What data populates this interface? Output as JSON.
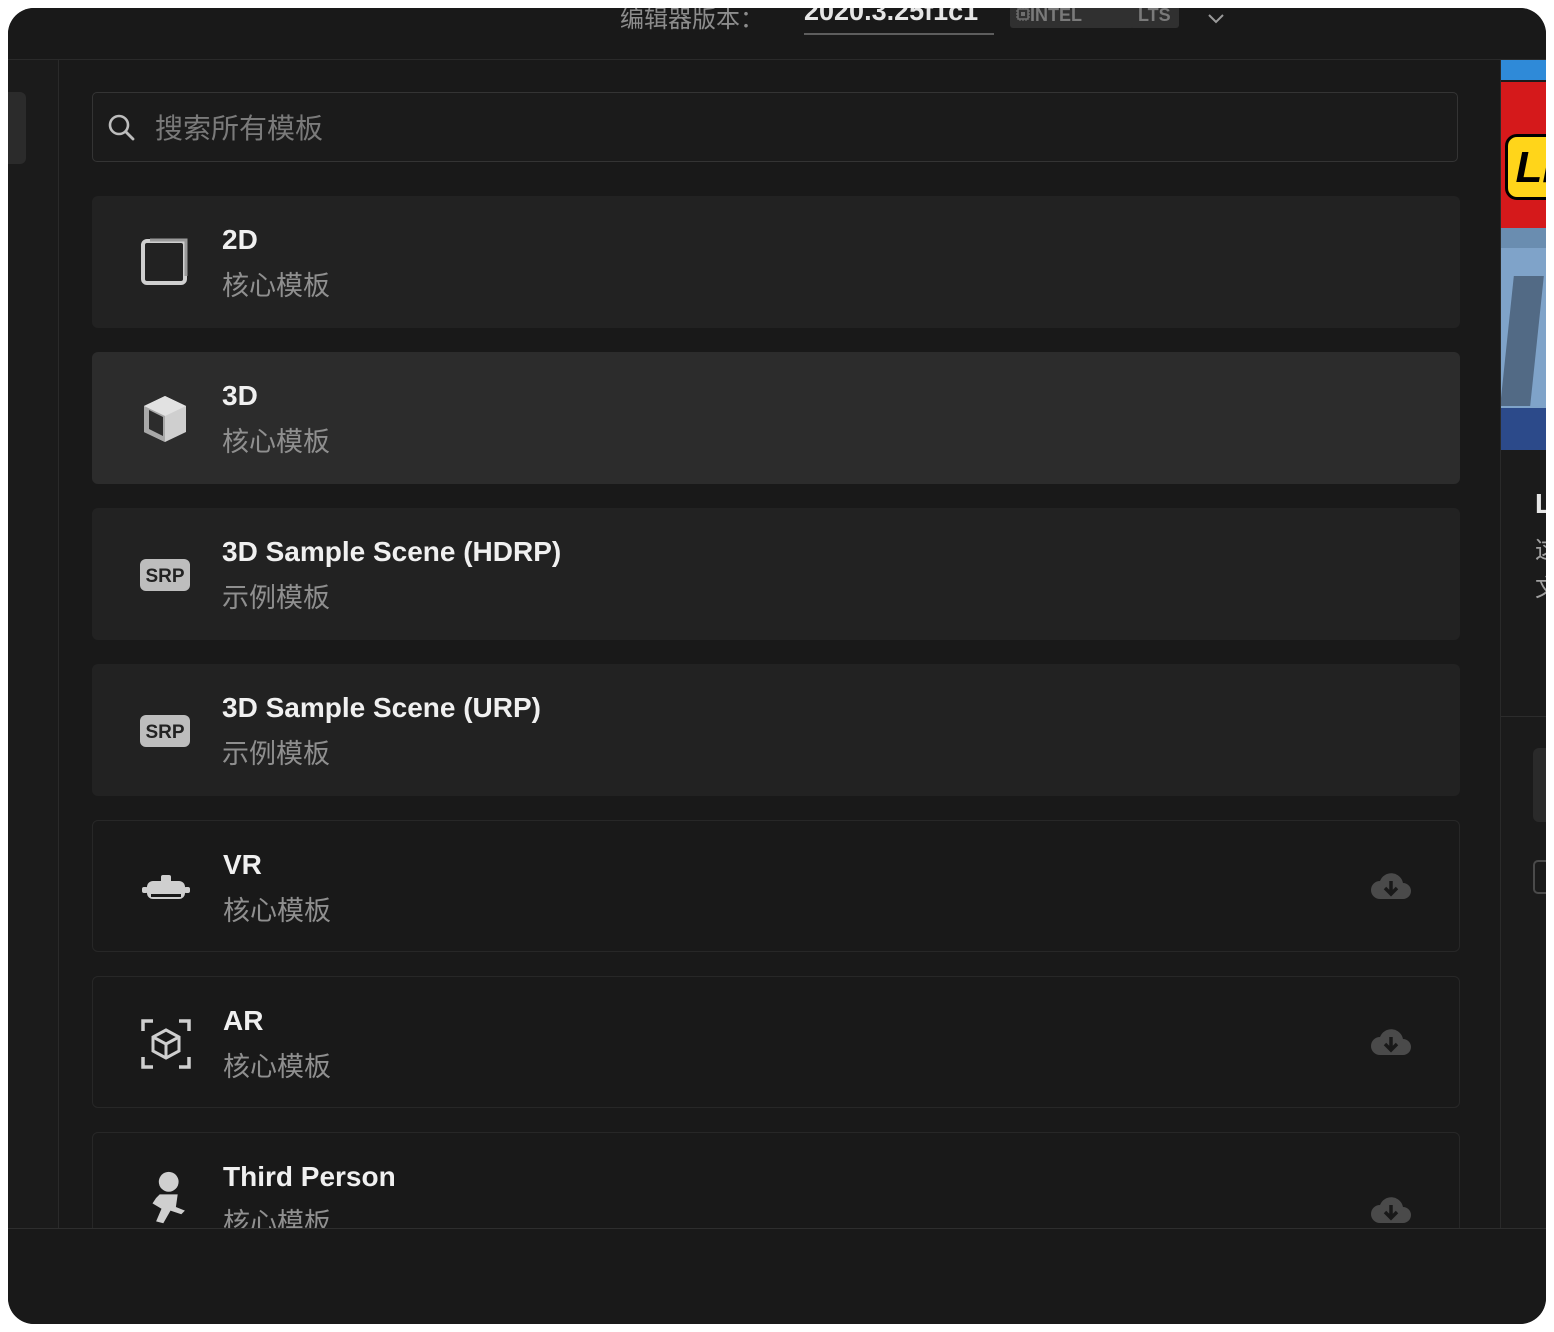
{
  "topbar": {
    "editor_version_label": "编辑器版本：",
    "editor_version_value": "2020.3.25f1c1",
    "badge_intel": "INTEL",
    "badge_lts": "LTS"
  },
  "search": {
    "placeholder": "搜索所有模板",
    "value": ""
  },
  "templates": [
    {
      "title": "2D",
      "subtitle": "核心模板",
      "icon": "square-2d-icon",
      "state": "local"
    },
    {
      "title": "3D",
      "subtitle": "核心模板",
      "icon": "cube-3d-icon",
      "state": "selected"
    },
    {
      "title": "3D Sample Scene (HDRP)",
      "subtitle": "示例模板",
      "icon": "srp-icon",
      "icon_text": "SRP",
      "state": "local"
    },
    {
      "title": "3D Sample Scene (URP)",
      "subtitle": "示例模板",
      "icon": "srp-icon",
      "icon_text": "SRP",
      "state": "local"
    },
    {
      "title": "VR",
      "subtitle": "核心模板",
      "icon": "vr-headset-icon",
      "state": "remote",
      "download": true
    },
    {
      "title": "AR",
      "subtitle": "核心模板",
      "icon": "ar-cube-icon",
      "state": "remote",
      "download": true
    },
    {
      "title": "Third Person",
      "subtitle": "核心模板",
      "icon": "third-person-icon",
      "state": "remote",
      "download": true
    }
  ],
  "right_panel": {
    "logo_text": "Ll",
    "initial": "L",
    "glyph1": "这",
    "glyph2": "文"
  },
  "colors": {
    "window_bg": "#191919",
    "card_bg": "#222222",
    "card_selected_bg": "#2c2c2c",
    "accent_blue": "#2f8ad8",
    "brand_red": "#d5191b",
    "brand_yellow": "#ffd51a"
  }
}
